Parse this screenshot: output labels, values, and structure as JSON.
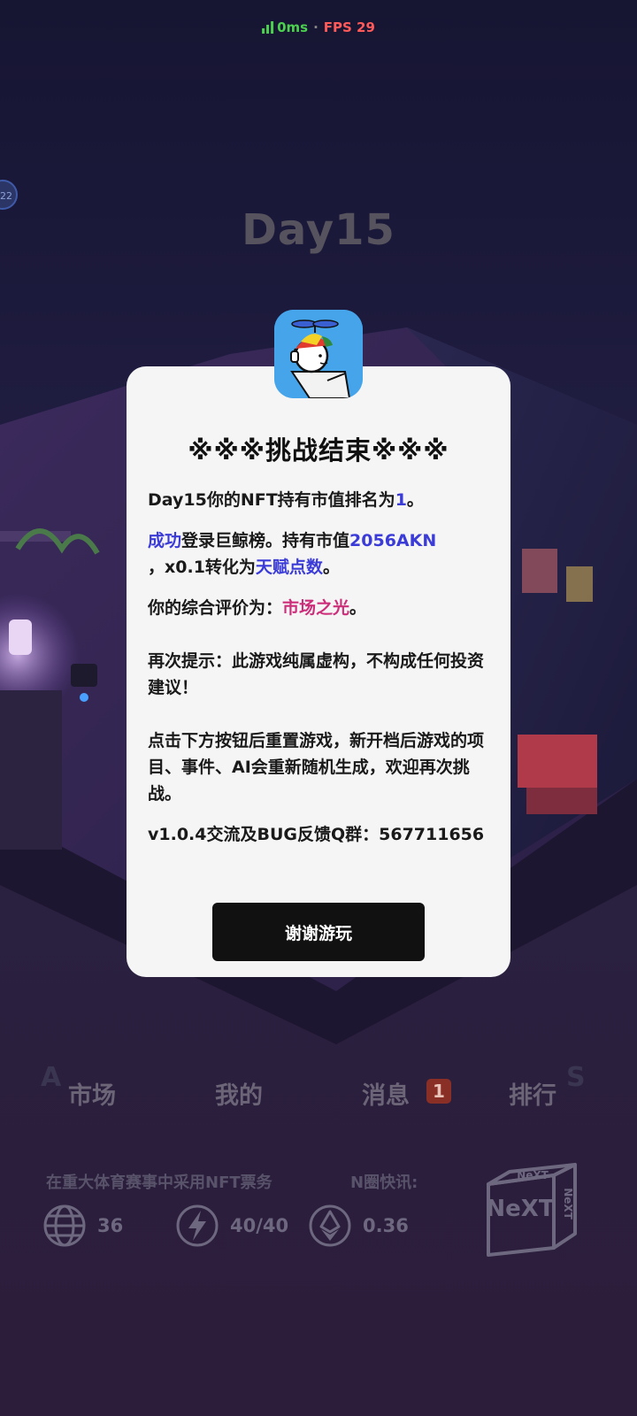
{
  "status": {
    "ping": "0ms",
    "separator": "·",
    "fps": "FPS 29"
  },
  "side_badge": "22",
  "day_title": "Day15",
  "dialog": {
    "title": "※※※挑战结束※※※",
    "rank_line": {
      "prefix": "Day15你的NFT持有市值排名为",
      "rank": "1",
      "suffix": "。"
    },
    "whale_line": {
      "success": "成功",
      "text1": "登录巨鲸榜。持有市值",
      "value": "2056AKN",
      "text2": "，x0.1转化为",
      "points": "天赋点数",
      "text3": "。"
    },
    "rating_line": {
      "prefix": "你的综合评价为：",
      "rating": "市场之光",
      "suffix": "。"
    },
    "notice": "再次提示：此游戏纯属虚构，不构成任何投资建议！",
    "reset_info": "点击下方按钮后重置游戏，新开档后游戏的项目、事件、AI会重新随机生成，欢迎再次挑战。",
    "version_info": "v1.0.4交流及BUG反馈Q群：567711656",
    "button": "谢谢游玩"
  },
  "nav": {
    "items": [
      "市场",
      "我的",
      "消息",
      "排行"
    ],
    "messages_badge": "1"
  },
  "ticker": {
    "headline": "在重大体育赛事中采用NFT票务",
    "label": "N圈快讯:"
  },
  "stats": {
    "globe": "36",
    "energy": "40/40",
    "eth": "0.36"
  },
  "logo": {
    "text_top": "NeXT",
    "text_front": "NeXT",
    "text_side": "NeXT"
  }
}
